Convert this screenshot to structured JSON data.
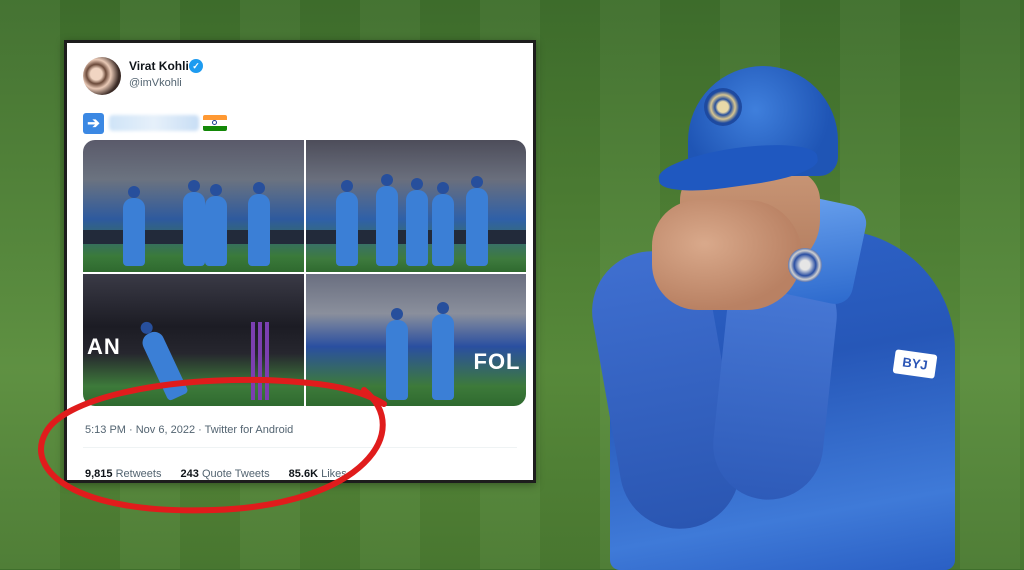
{
  "tweet": {
    "author_name": "Virat Kohli",
    "author_handle": "@imVkohli",
    "verified_icon": "check",
    "text_emojis": [
      "right-arrow-emoji",
      "india-flag-emoji"
    ],
    "photos": [
      "photo-1",
      "photo-2",
      "photo-3",
      "photo-4"
    ],
    "photo_board_text": {
      "photo_3": "AN",
      "photo_4": "FOL"
    },
    "timestamp": "5:13 PM · Nov 6, 2022 · Twitter for Android",
    "stats": {
      "retweets_count": "9,815",
      "retweets_label": "Retweets",
      "quotes_count": "243",
      "quotes_label": "Quote Tweets",
      "likes_count": "85.6K",
      "likes_label": "Likes"
    }
  },
  "player": {
    "sponsor_text": "BYJ"
  },
  "annotation": {
    "circle_color": "#e01c1c"
  },
  "colors": {
    "twitter_blue": "#1d9bf0",
    "jersey_blue": "#2f64c9",
    "grass_green": "#4d7f34"
  }
}
